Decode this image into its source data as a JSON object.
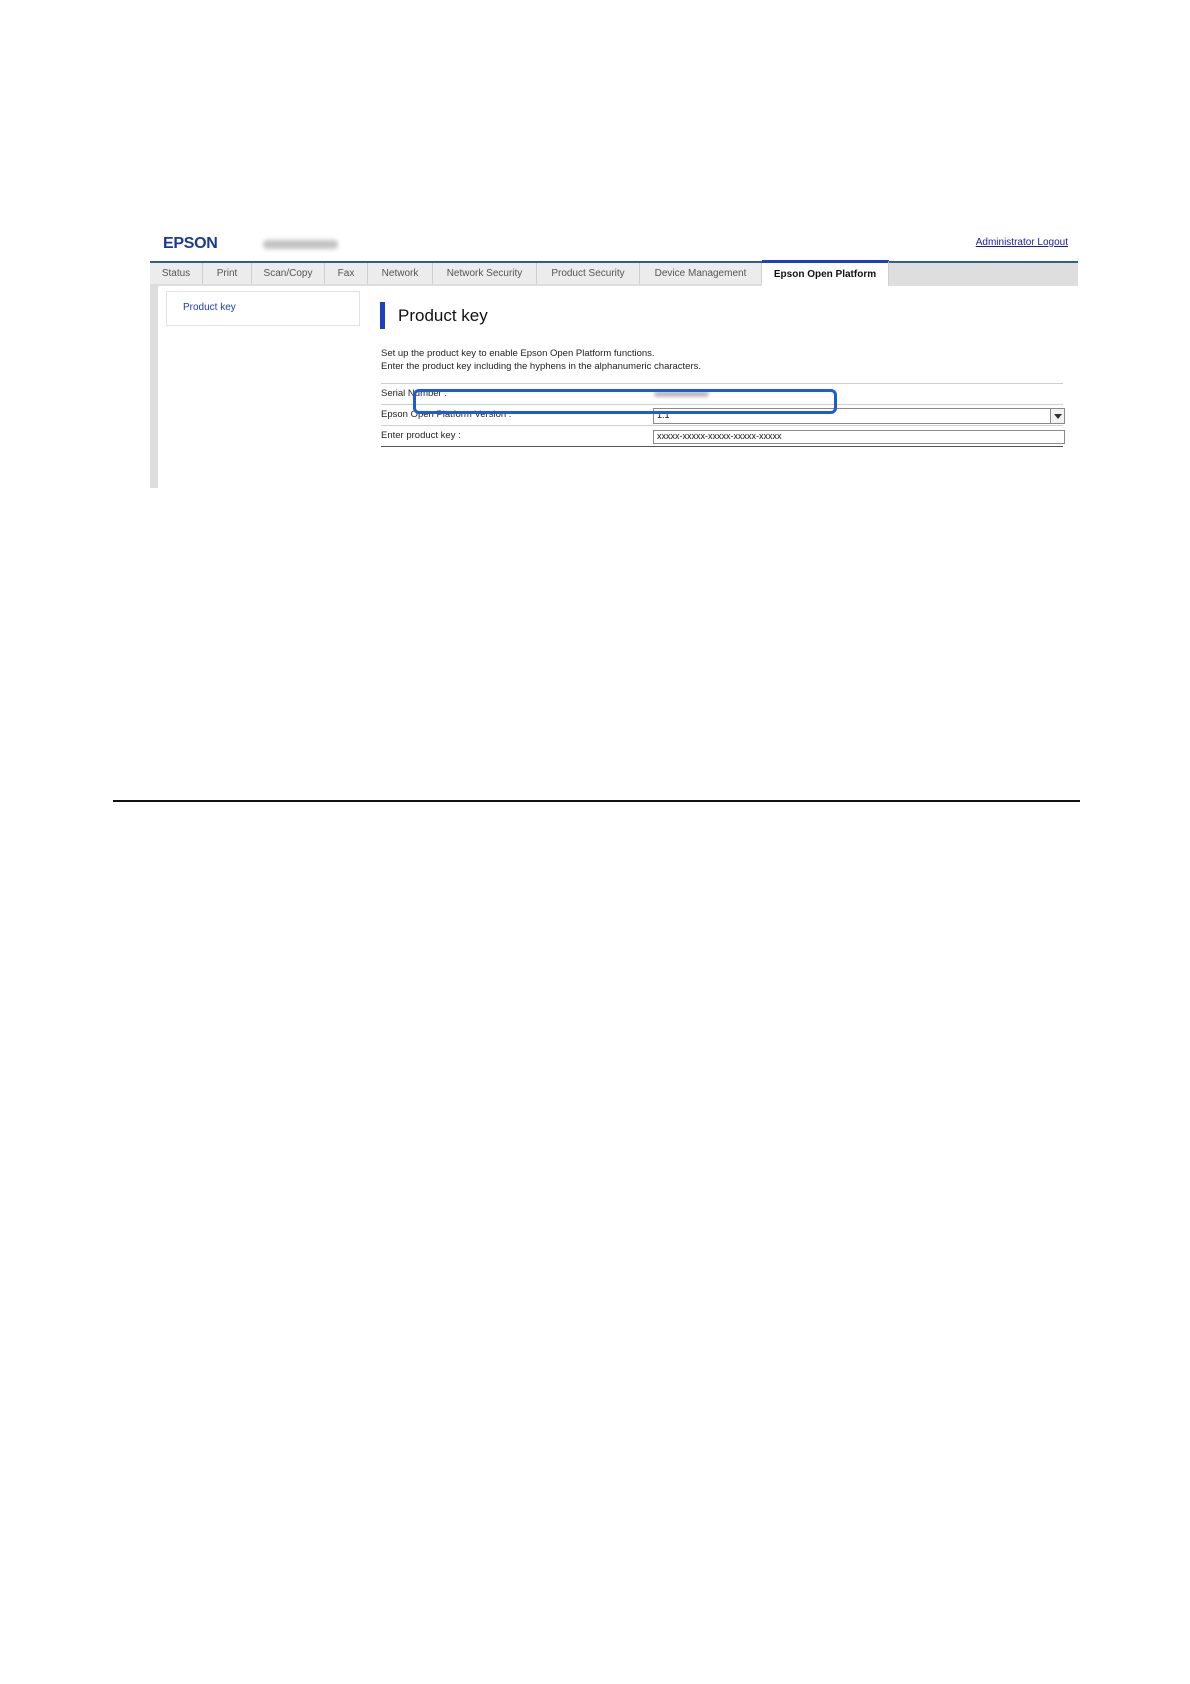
{
  "header": {
    "logo_text": "EPSON",
    "logout_link": "Administrator Logout"
  },
  "tabs": [
    {
      "label": "Status"
    },
    {
      "label": "Print"
    },
    {
      "label": "Scan/Copy"
    },
    {
      "label": "Fax"
    },
    {
      "label": "Network"
    },
    {
      "label": "Network Security"
    },
    {
      "label": "Product Security"
    },
    {
      "label": "Device Management"
    },
    {
      "label": "Epson Open Platform",
      "active": true
    }
  ],
  "sidebar": {
    "items": [
      {
        "label": "Product key"
      }
    ]
  },
  "main": {
    "title": "Product key",
    "description_line1": "Set up the product key to enable Epson Open Platform functions.",
    "description_line2": "Enter the product key including the hyphens in the alphanumeric characters.",
    "rows": [
      {
        "label": "Serial Number :"
      },
      {
        "label": "Epson Open Platform Version :",
        "selected_value": "1.1"
      },
      {
        "label": "Enter product key :",
        "input_value": "xxxxx-xxxxx-xxxxx-xxxxx-xxxxx"
      }
    ]
  },
  "colors": {
    "accent": "#1e3fbf",
    "highlight_box": "#1e5cd4",
    "link": "#1a3fb8"
  }
}
